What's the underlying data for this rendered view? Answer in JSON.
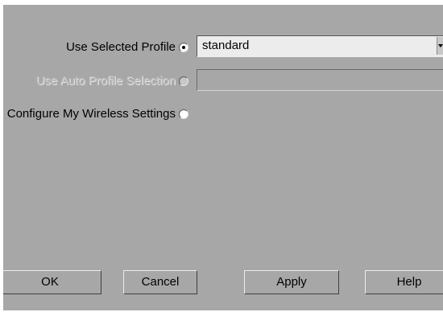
{
  "profile_options": {
    "use_selected_profile": {
      "label": "Use Selected Profile",
      "selected": true,
      "enabled": true
    },
    "use_auto_profile_selection": {
      "label": "Use Auto Profile Selection",
      "selected": false,
      "enabled": false
    },
    "configure_wireless_settings": {
      "label": "Configure My Wireless Settings",
      "selected": false,
      "enabled": true
    }
  },
  "profile_select": {
    "value": "standard"
  },
  "auto_profile_field": {
    "value": ""
  },
  "buttons": {
    "ok": "OK",
    "cancel": "Cancel",
    "apply": "Apply",
    "help": "Help"
  }
}
